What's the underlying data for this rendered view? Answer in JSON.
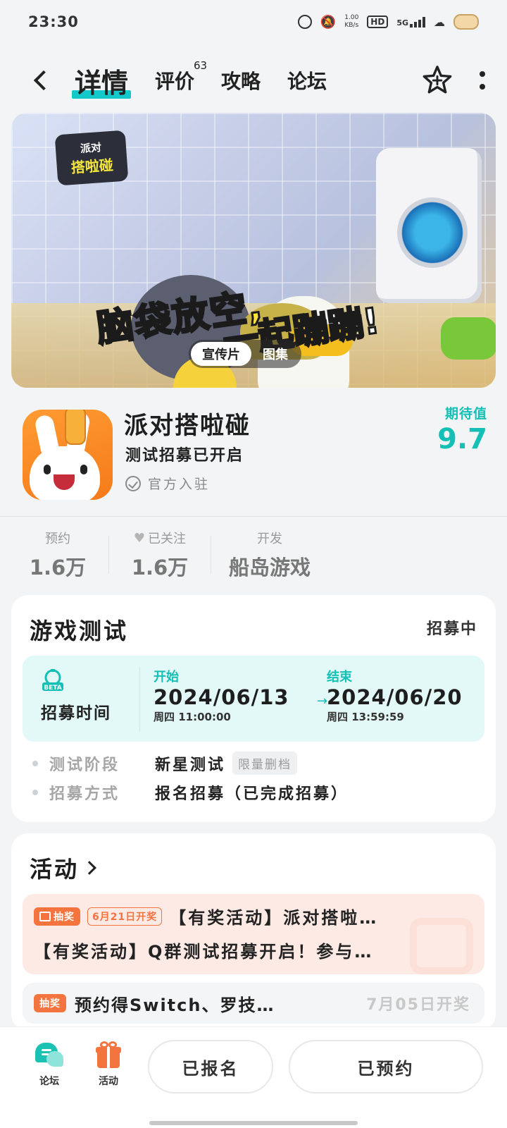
{
  "status_bar": {
    "time": "23:30",
    "net_speed_value": "1.00",
    "net_speed_unit": "KB/s",
    "hd": "HD",
    "network": "5G",
    "icons": [
      "alarm-icon",
      "mute-icon",
      "signal-icon",
      "battery-icon"
    ]
  },
  "nav": {
    "tabs": [
      {
        "label": "详情",
        "active": true
      },
      {
        "label": "评价",
        "count": "63"
      },
      {
        "label": "攻略"
      },
      {
        "label": "论坛"
      }
    ]
  },
  "banner": {
    "logo_line1": "派对",
    "logo_line2": "搭啦碰",
    "slogan_part1": "脑袋放空,",
    "slogan_part2": "一起蹦蹦!",
    "switch": [
      {
        "label": "宣传片",
        "active": true
      },
      {
        "label": "图集",
        "active": false
      }
    ]
  },
  "app": {
    "name": "派对搭啦碰",
    "subtitle": "测试招募已开启",
    "official": "官方入驻",
    "expect_label": "期待值",
    "expect_value": "9.7"
  },
  "stats": [
    {
      "label": "预约",
      "value": "1.6万"
    },
    {
      "label": "已关注",
      "value": "1.6万"
    },
    {
      "label": "开发",
      "value": "船岛游戏"
    }
  ],
  "test_section": {
    "title": "游戏测试",
    "status": "招募中",
    "beta_label": "BETA",
    "recruit_label": "招募时间",
    "start_label": "开始",
    "start_date": "2024/06/13",
    "start_time": "周四 11:00:00",
    "arrow": "→",
    "end_label": "结束",
    "end_date": "2024/06/20",
    "end_time": "周四 13:59:59",
    "rows": [
      {
        "key": "测试阶段",
        "value": "新星测试",
        "tag": "限量删档"
      },
      {
        "key": "招募方式",
        "value": "报名招募（已完成招募）"
      }
    ]
  },
  "activity": {
    "title": "活动",
    "item1_badge": "抽奖",
    "item1_date": "6月21日开奖",
    "item1_text": "【有奖活动】派对搭啦…",
    "item2_text": "【有奖活动】Q群测试招募开启！参与…",
    "item3_badge": "抽奖",
    "item3_text": "预约得Switch、罗技…",
    "item3_date": "7月05日开奖"
  },
  "bottom_bar": {
    "forum_label": "论坛",
    "activity_label": "活动",
    "registered_label": "已报名",
    "reserved_label": "已预约"
  },
  "colors": {
    "accent": "#14c0b5",
    "orange": "#f3743f",
    "background": "#f2f4f5"
  }
}
